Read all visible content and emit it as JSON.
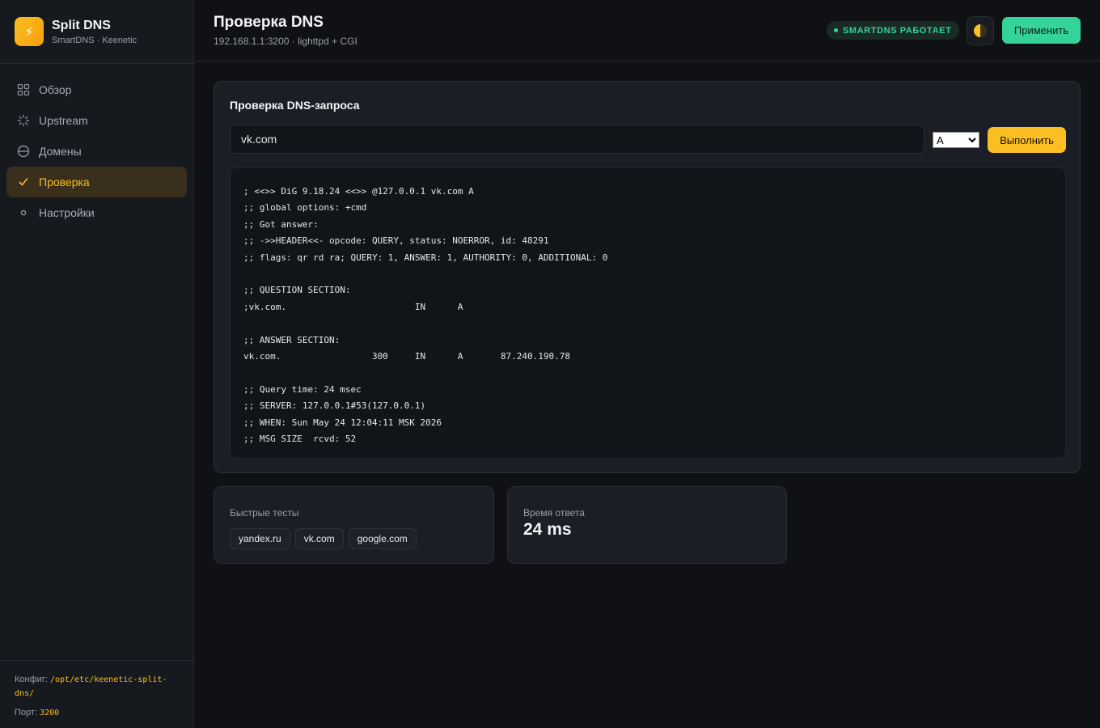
{
  "brand": {
    "title": "Split DNS",
    "subtitle": "SmartDNS · Keenetic",
    "logo_icon": "lightning-bolt-icon"
  },
  "nav": {
    "items": [
      {
        "label": "Обзор",
        "icon": "grid-icon",
        "active": false
      },
      {
        "label": "Upstream",
        "icon": "spinner-icon",
        "active": false
      },
      {
        "label": "Домены",
        "icon": "globe-icon",
        "active": false
      },
      {
        "label": "Проверка",
        "icon": "check-icon",
        "active": true
      },
      {
        "label": "Настройки",
        "icon": "dot-icon",
        "active": false
      }
    ]
  },
  "footer": {
    "config_label": "Конфиг:",
    "config_path": "/opt/etc/keenetic-split-dns/",
    "port_label": "Порт:",
    "port_value": "3200"
  },
  "header": {
    "title": "Проверка DNS",
    "subtitle": "192.168.1.1:3200 · lighttpd + CGI",
    "status": "SMARTDNS РАБОТАЕТ",
    "apply_label": "Применить"
  },
  "query": {
    "card_title": "Проверка DNS-запроса",
    "input_value": "vk.com",
    "type_selected": "A",
    "run_label": "Выполнить",
    "output": "; <<>> DiG 9.18.24 <<>> @127.0.0.1 vk.com A\n;; global options: +cmd\n;; Got answer:\n;; ->>HEADER<<- opcode: QUERY, status: NOERROR, id: 48291\n;; flags: qr rd ra; QUERY: 1, ANSWER: 1, AUTHORITY: 0, ADDITIONAL: 0\n\n;; QUESTION SECTION:\n;vk.com.                        IN      A\n\n;; ANSWER SECTION:\nvk.com.                 300     IN      A       87.240.190.78\n\n;; Query time: 24 msec\n;; SERVER: 127.0.0.1#53(127.0.0.1)\n;; WHEN: Sun May 24 12:04:11 MSK 2026\n;; MSG SIZE  rcvd: 52"
  },
  "quick_tests": {
    "label": "Быстрые тесты",
    "items": [
      "yandex.ru",
      "vk.com",
      "google.com"
    ]
  },
  "response_time": {
    "label": "Время ответа",
    "value": "24 ms"
  },
  "colors": {
    "accent": "#fbbf24",
    "success": "#34d399",
    "background": "#0f1115",
    "card": "#1b1f25"
  }
}
